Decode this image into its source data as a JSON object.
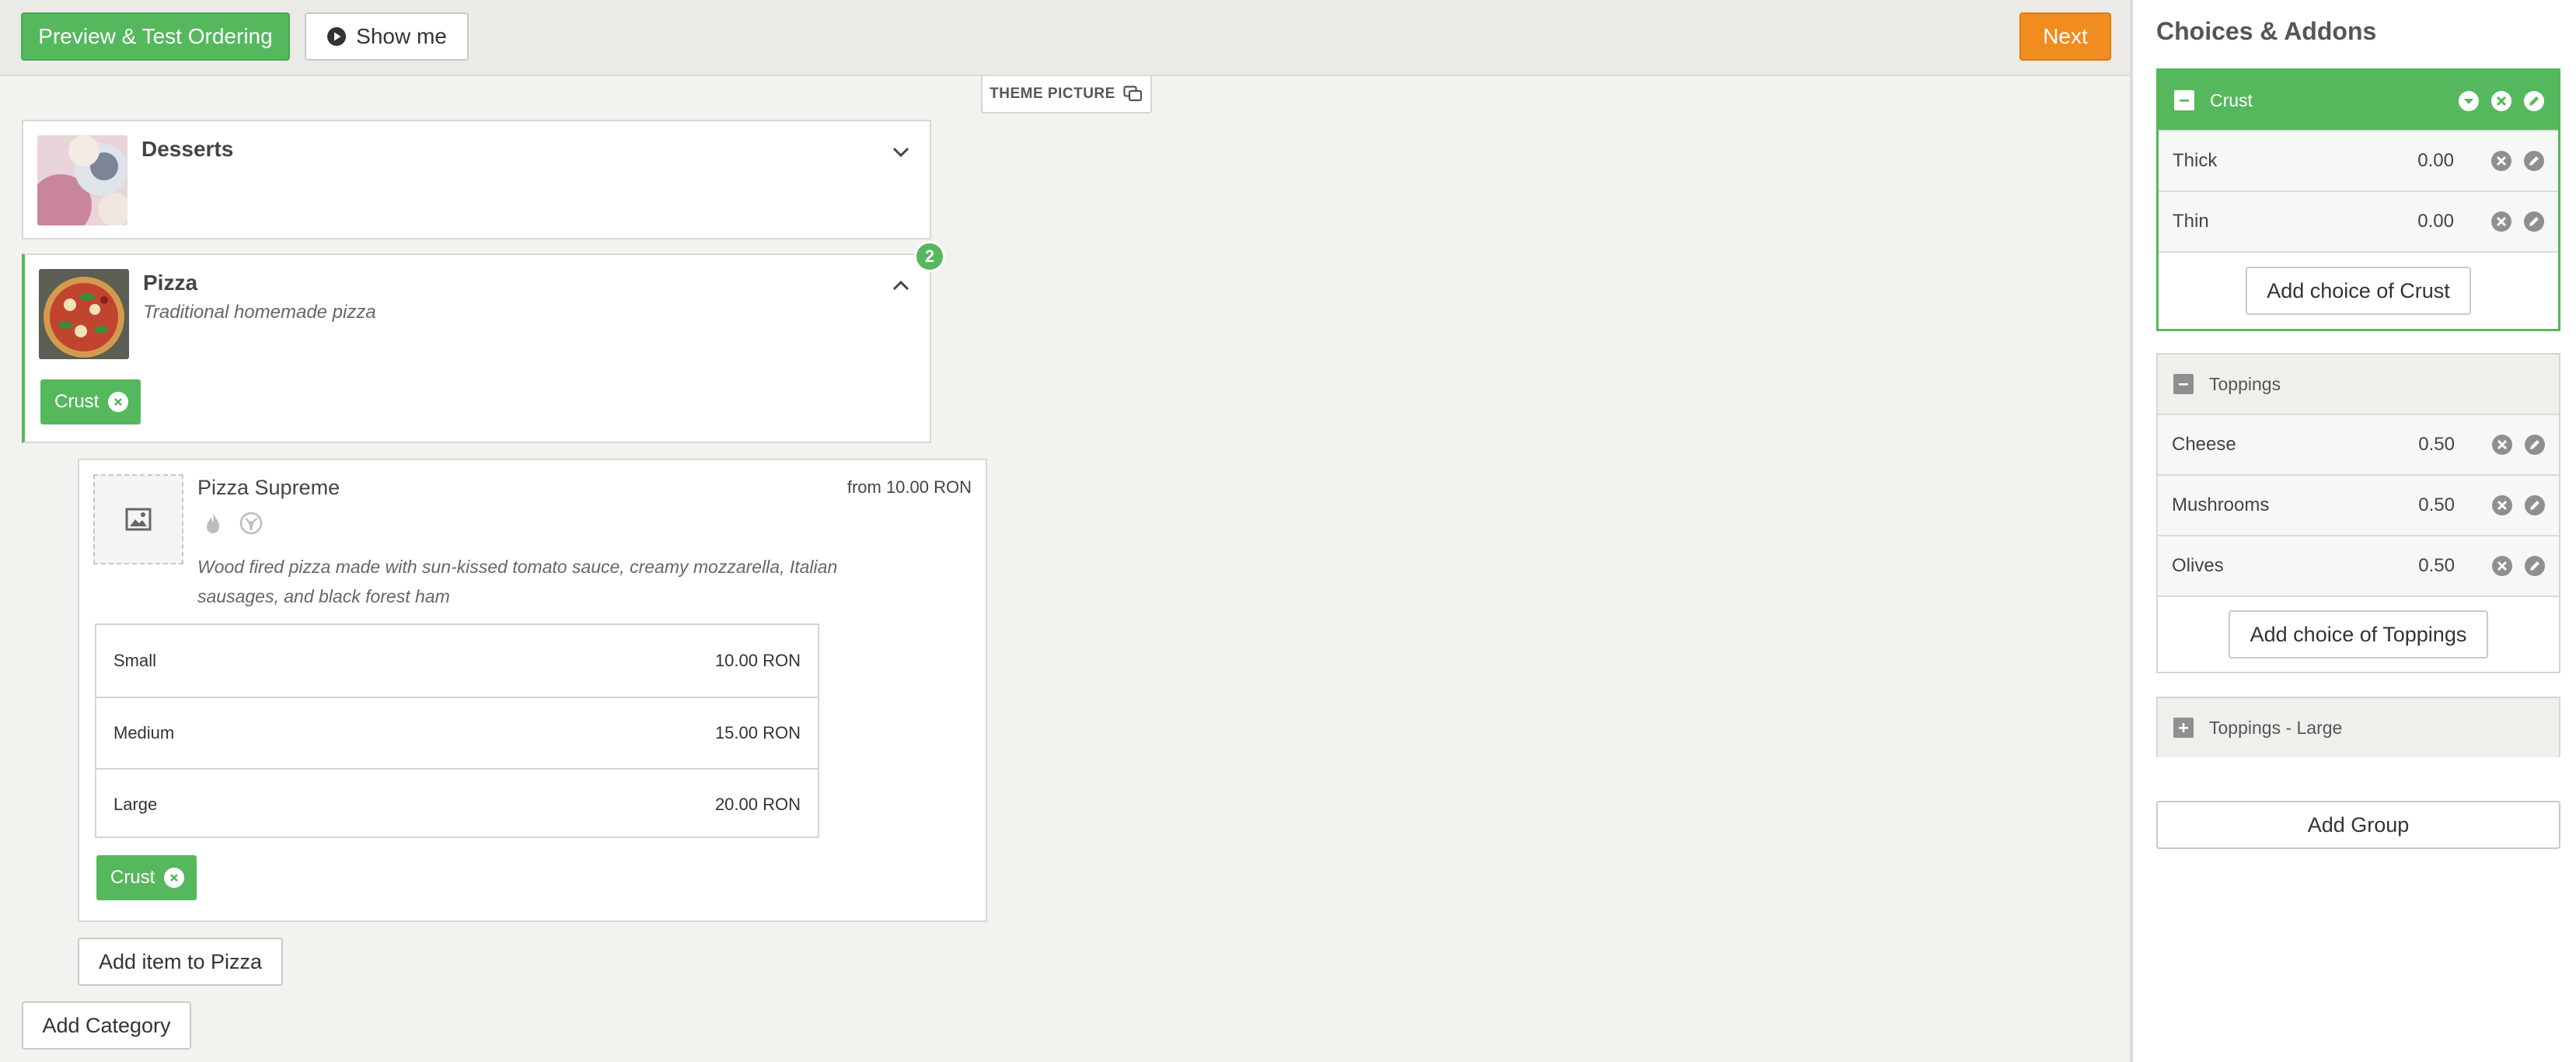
{
  "toolbar": {
    "preview_label": "Preview & Test Ordering",
    "showme_label": "Show me",
    "next_label": "Next"
  },
  "theme_picture_label": "THEME PICTURE",
  "categories": [
    {
      "name": "Desserts",
      "description": "",
      "expanded": false
    },
    {
      "name": "Pizza",
      "description": "Traditional homemade pizza",
      "expanded": true,
      "badge_count": "2",
      "tags": [
        "Crust"
      ]
    }
  ],
  "item": {
    "name": "Pizza Supreme",
    "price_from": "from 10.00 RON",
    "description": "Wood fired pizza made with sun-kissed tomato sauce, creamy mozzarella, Italian sausages, and black forest ham",
    "sizes": [
      {
        "name": "Small",
        "price": "10.00 RON"
      },
      {
        "name": "Medium",
        "price": "15.00 RON"
      },
      {
        "name": "Large",
        "price": "20.00 RON"
      }
    ],
    "tags": [
      "Crust"
    ],
    "icons": [
      "spicy-icon",
      "vegetarian-icon"
    ]
  },
  "add_item_label": "Add item to Pizza",
  "add_category_label": "Add Category",
  "panel": {
    "title": "Choices & Addons",
    "groups": [
      {
        "name": "Crust",
        "active": true,
        "choices": [
          {
            "name": "Thick",
            "price": "0.00"
          },
          {
            "name": "Thin",
            "price": "0.00"
          }
        ],
        "add_label": "Add choice of Crust"
      },
      {
        "name": "Toppings",
        "active": false,
        "choices": [
          {
            "name": "Cheese",
            "price": "0.50"
          },
          {
            "name": "Mushrooms",
            "price": "0.50"
          },
          {
            "name": "Olives",
            "price": "0.50"
          }
        ],
        "add_label": "Add choice of Toppings"
      },
      {
        "name": "Toppings - Large",
        "active": false,
        "collapsed": true
      }
    ],
    "add_group_label": "Add Group"
  },
  "colors": {
    "green": "#55b85d",
    "orange": "#f18c1e",
    "background": "#f3f2ee"
  }
}
